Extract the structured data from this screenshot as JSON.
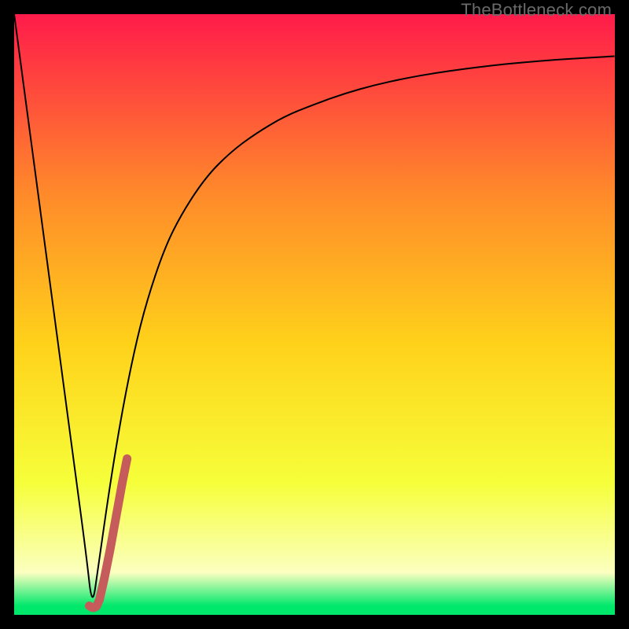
{
  "watermark": {
    "text": "TheBottleneck.com"
  },
  "colors": {
    "top": "#ff1b4a",
    "upper_mid": "#ff8a2a",
    "mid": "#ffd21a",
    "lower_mid": "#f6ff3a",
    "pale": "#fbffc0",
    "green": "#00e86b",
    "curve": "#000000",
    "accent": "#c65b5b",
    "frame": "#000000"
  },
  "chart_data": {
    "type": "line",
    "title": "",
    "xlabel": "",
    "ylabel": "",
    "xlim": [
      0,
      100
    ],
    "ylim": [
      0,
      100
    ],
    "series": [
      {
        "name": "bottleneck-curve",
        "x": [
          0,
          2,
          4,
          6,
          8,
          10,
          12,
          13,
          14,
          16,
          18,
          20,
          22,
          25,
          28,
          32,
          36,
          40,
          45,
          50,
          55,
          60,
          65,
          70,
          75,
          80,
          85,
          90,
          95,
          100
        ],
        "y": [
          100,
          85,
          70,
          55,
          40,
          25,
          10,
          1,
          8,
          22,
          34,
          44,
          52,
          61,
          67,
          73,
          77,
          80,
          83,
          85,
          86.8,
          88.2,
          89.3,
          90.2,
          90.9,
          91.5,
          92.0,
          92.4,
          92.7,
          93.0
        ]
      },
      {
        "name": "accent-segment",
        "x": [
          12.5,
          13.0,
          13.3,
          13.7,
          14.2,
          15.0,
          16.0,
          17.0,
          18.0,
          18.8
        ],
        "y": [
          1.5,
          1.2,
          1.2,
          1.4,
          2.5,
          6.0,
          11.0,
          16.5,
          22.0,
          26.0
        ]
      }
    ],
    "gradient_stops": [
      {
        "offset": 0.0,
        "key": "top"
      },
      {
        "offset": 0.3,
        "key": "upper_mid"
      },
      {
        "offset": 0.55,
        "key": "mid"
      },
      {
        "offset": 0.78,
        "key": "lower_mid"
      },
      {
        "offset": 0.93,
        "key": "pale"
      },
      {
        "offset": 0.985,
        "key": "green"
      },
      {
        "offset": 1.0,
        "key": "green"
      }
    ]
  }
}
